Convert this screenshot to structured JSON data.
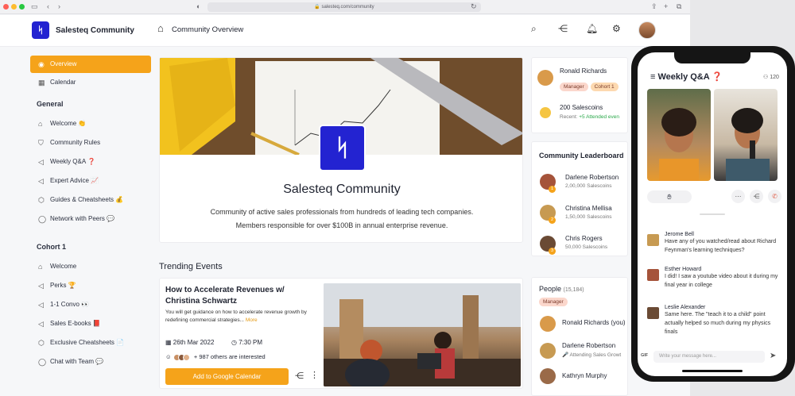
{
  "browser": {
    "url": "salesteq.com/community"
  },
  "header": {
    "brand": "Salesteq Community",
    "page_title": "Community Overview"
  },
  "sidebar": {
    "top_items": [
      {
        "label": "Overview",
        "icon": "eye-icon"
      },
      {
        "label": "Calendar",
        "icon": "calendar-icon"
      }
    ],
    "general_heading": "General",
    "general_items": [
      {
        "label": "Welcome 👏",
        "icon": "home-icon"
      },
      {
        "label": "Community Rules",
        "icon": "shield-icon"
      },
      {
        "label": "Weekly Q&A ❓",
        "icon": "megaphone-icon"
      },
      {
        "label": "Expert Advice 📈",
        "icon": "megaphone-icon"
      },
      {
        "label": "Guides & Cheatsheets 💰",
        "icon": "box-icon"
      },
      {
        "label": "Network with Peers 💬",
        "icon": "chat-icon"
      }
    ],
    "cohort_heading": "Cohort 1",
    "cohort_items": [
      {
        "label": "Welcome",
        "icon": "home-icon"
      },
      {
        "label": "Perks 🏆",
        "icon": "megaphone-icon"
      },
      {
        "label": "1-1 Convo 👀",
        "icon": "megaphone-icon"
      },
      {
        "label": "Sales E-books 📕",
        "icon": "megaphone-icon"
      },
      {
        "label": "Exclusive Cheatsheets 📄",
        "icon": "box-icon"
      },
      {
        "label": "Chat with Team 💬",
        "icon": "chat-icon"
      }
    ]
  },
  "hero": {
    "title": "Salesteq Community",
    "desc_line1": "Community of active sales professionals from hundreds of leading tech companies.",
    "desc_line2": "Members responsible for over $100B in annual enterprise revenue."
  },
  "trending": {
    "heading": "Trending Events",
    "event": {
      "title": "How to Accelerate Revenues w/ Christina Schwartz",
      "desc": "You will get guidance on how to accelerate revenue growth by redefining commercial strategies...",
      "more": "More",
      "date": "26th Mar 2022",
      "time": "7:30 PM",
      "interested": "+ 987 others are interested",
      "button": "Add to Google Calendar"
    }
  },
  "profile": {
    "name": "Ronald Richards",
    "tags": [
      "Manager",
      "Cohort 1"
    ],
    "coins": "200 Salescoins",
    "recent_label": "Recent:",
    "recent_value": "+5 Attended even"
  },
  "leaderboard": {
    "heading": "Community Leaderboard",
    "entries": [
      {
        "name": "Darlene Robertson",
        "coins": "2,00,000 Salescoins",
        "rank": "1"
      },
      {
        "name": "Christina Mellisa",
        "coins": "1,50,000 Salescoins",
        "rank": "2"
      },
      {
        "name": "Chris Rogers",
        "coins": "50,000 Salescoins",
        "rank": "3"
      }
    ]
  },
  "people": {
    "heading": "People",
    "count": "(15,184)",
    "filter": "Manager",
    "entries": [
      {
        "name": "Ronald Richards (you)",
        "sub": ""
      },
      {
        "name": "Darlene Robertson",
        "sub": "🎤 Attending Sales Growt"
      },
      {
        "name": "Kathryn Murphy",
        "sub": ""
      }
    ]
  },
  "phone": {
    "title": "Weekly Q&A",
    "title_emoji": "❓",
    "viewers": "120",
    "messages": [
      {
        "name": "Jerome Bell",
        "text": "Have any of you watched/read about Richard Feynman's learning techniques?"
      },
      {
        "name": "Esther Howard",
        "text": "I did! I saw a youtube video about it during my final year in college"
      },
      {
        "name": "Leslie Alexander",
        "text": "Same here. The \"teach it to a child\" point actually helped so much during my physics finals"
      }
    ],
    "gif_label": "GIF",
    "input_placeholder": "Write your message here..."
  },
  "colors": {
    "accent": "#f5a31a",
    "brand": "#2323d1"
  }
}
